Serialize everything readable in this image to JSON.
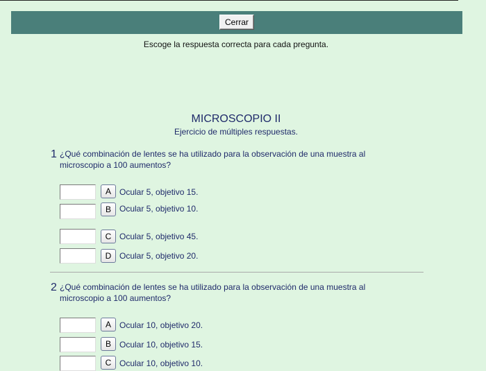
{
  "header": {
    "close_label": "Cerrar"
  },
  "instruction": "Escoge la respuesta correcta para cada pregunta.",
  "quiz": {
    "title": "MICROSCOPIO II",
    "subtitle": "Ejercicio de múltiples respuestas."
  },
  "questions": [
    {
      "number": "1",
      "text": "¿Qué combinación de lentes se ha utilizado para la observación de una muestra al microscopio a 100 aumentos?",
      "options": [
        {
          "letter": "A",
          "text": "Ocular 5, objetivo 15."
        },
        {
          "letter": "B",
          "text": "Ocular 5, objetivo 10."
        },
        {
          "letter": "C",
          "text": "Ocular 5, objetivo 45."
        },
        {
          "letter": "D",
          "text": "Ocular 5, objetivo 20."
        }
      ]
    },
    {
      "number": "2",
      "text": "¿Qué combinación de lentes se ha utilizado para la observación de una muestra al microscopio a 100 aumentos?",
      "options": [
        {
          "letter": "A",
          "text": "Ocular 10, objetivo 20."
        },
        {
          "letter": "B",
          "text": "Ocular 10, objetivo 15."
        },
        {
          "letter": "C",
          "text": "Ocular 10, objetivo 10."
        }
      ]
    }
  ]
}
